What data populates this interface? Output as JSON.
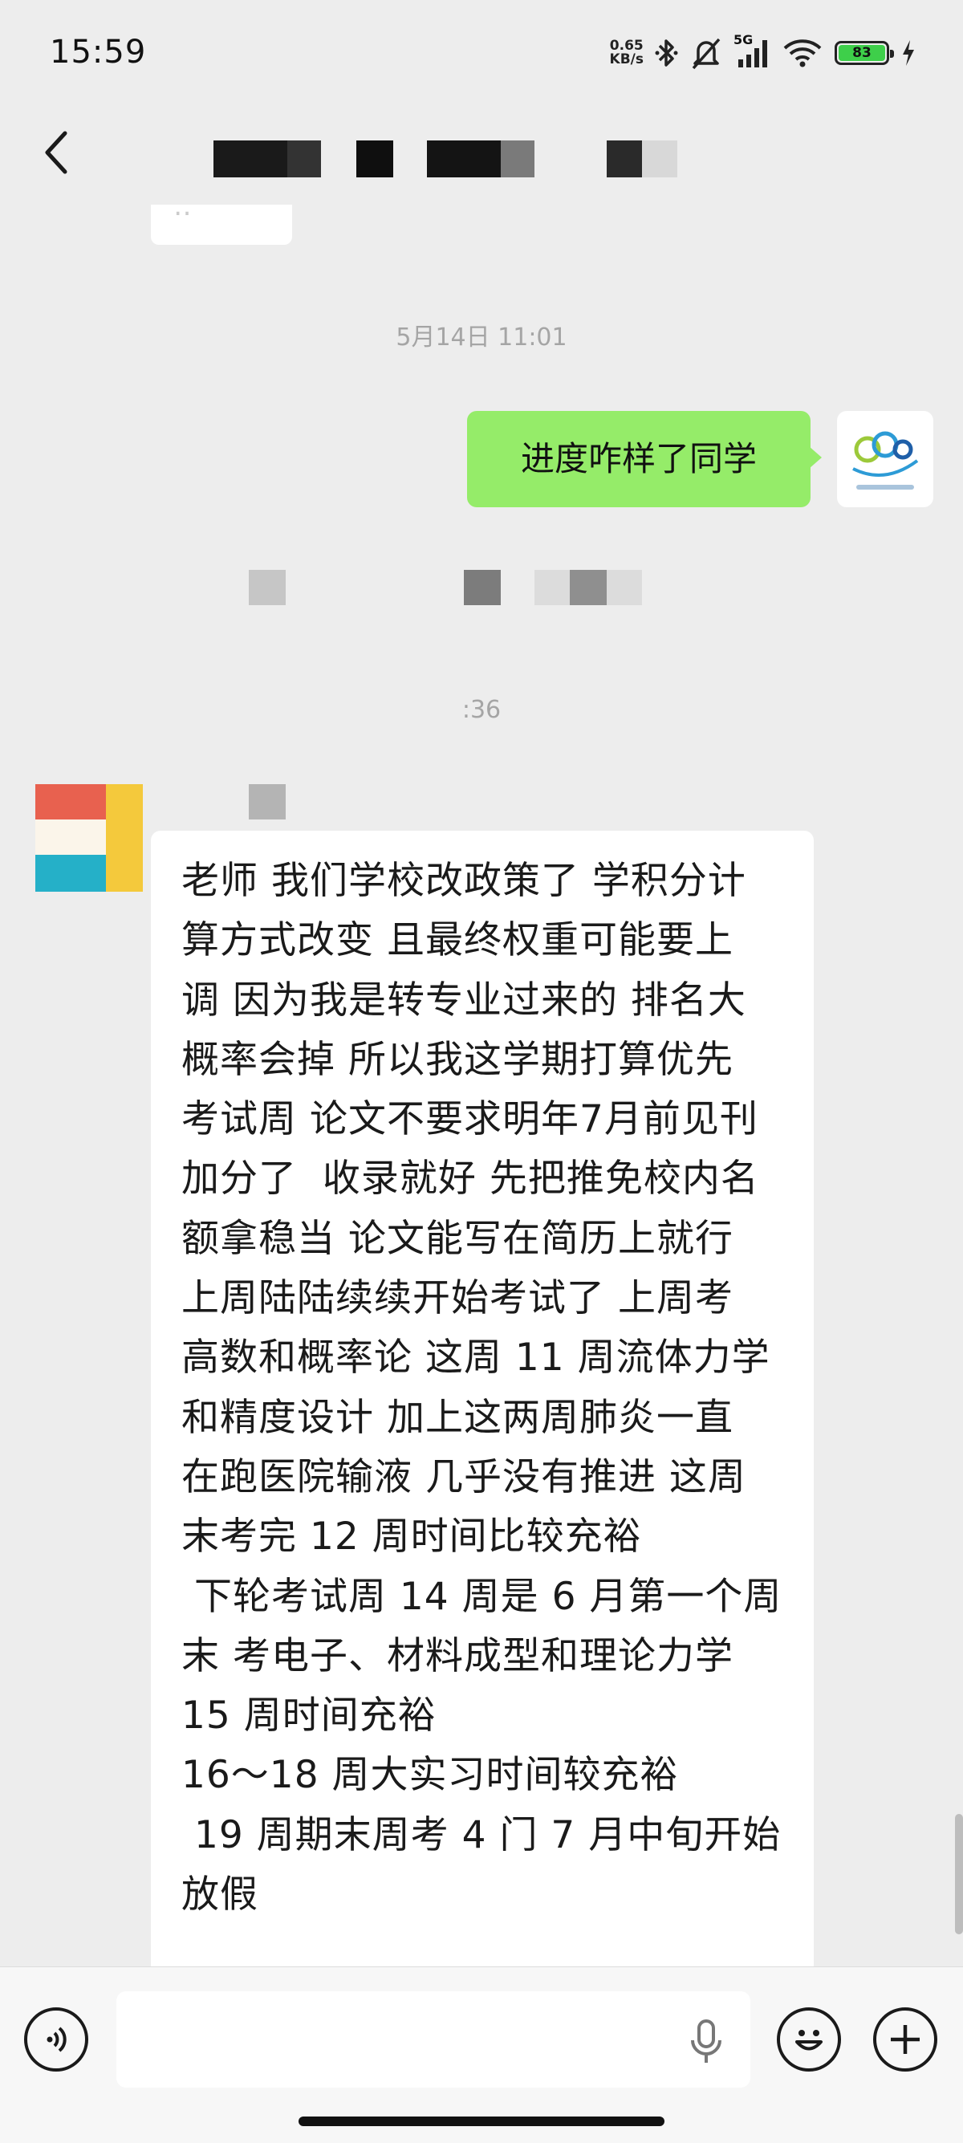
{
  "status_bar": {
    "time": "15:59",
    "net_speed_value": "0.65",
    "net_speed_unit": "KB/s",
    "network_type": "5G",
    "battery_level": "83"
  },
  "header": {
    "back_icon": "chevron-left-icon",
    "title_redacted": true
  },
  "chat": {
    "partial_prev_message_visible": true,
    "timestamp_1": "5月14日 11:01",
    "sent_message": "进度咋样了同学",
    "timestamp_2": ":36",
    "received_lines": [
      "老师 我们学校改政策了 学积分计",
      "算方式改变 且最终权重可能要上",
      "调 因为我是转专业过来的 排名大",
      "概率会掉 所以我这学期打算优先",
      "考试周 论文不要求明年7月前见刊",
      "加分了  收录就好 先把推免校内名",
      "额拿稳当 论文能写在简历上就行",
      "上周陆陆续续开始考试了 上周考",
      "高数和概率论 这周 11 周流体力学",
      "和精度设计 加上这两周肺炎一直",
      "在跑医院输液 几乎没有推进 这周",
      "末考完 12 周时间比较充裕",
      " 下轮考试周 14 周是 6 月第一个周",
      "末 考电子、材料成型和理论力学",
      "15 周时间充裕",
      "16～18 周大实习时间较充裕",
      " 19 周期末周考 4 门 7 月中旬开始",
      "放假"
    ]
  },
  "input_bar": {
    "text_value": "",
    "voice_icon": "voice-mode-icon",
    "mic_icon": "microphone-icon",
    "emoji_icon": "emoji-icon",
    "plus_icon": "plus-icon"
  },
  "colors": {
    "sent_bubble": "#95ec69",
    "background": "#ededed",
    "battery_fill": "#3ecf4a"
  }
}
